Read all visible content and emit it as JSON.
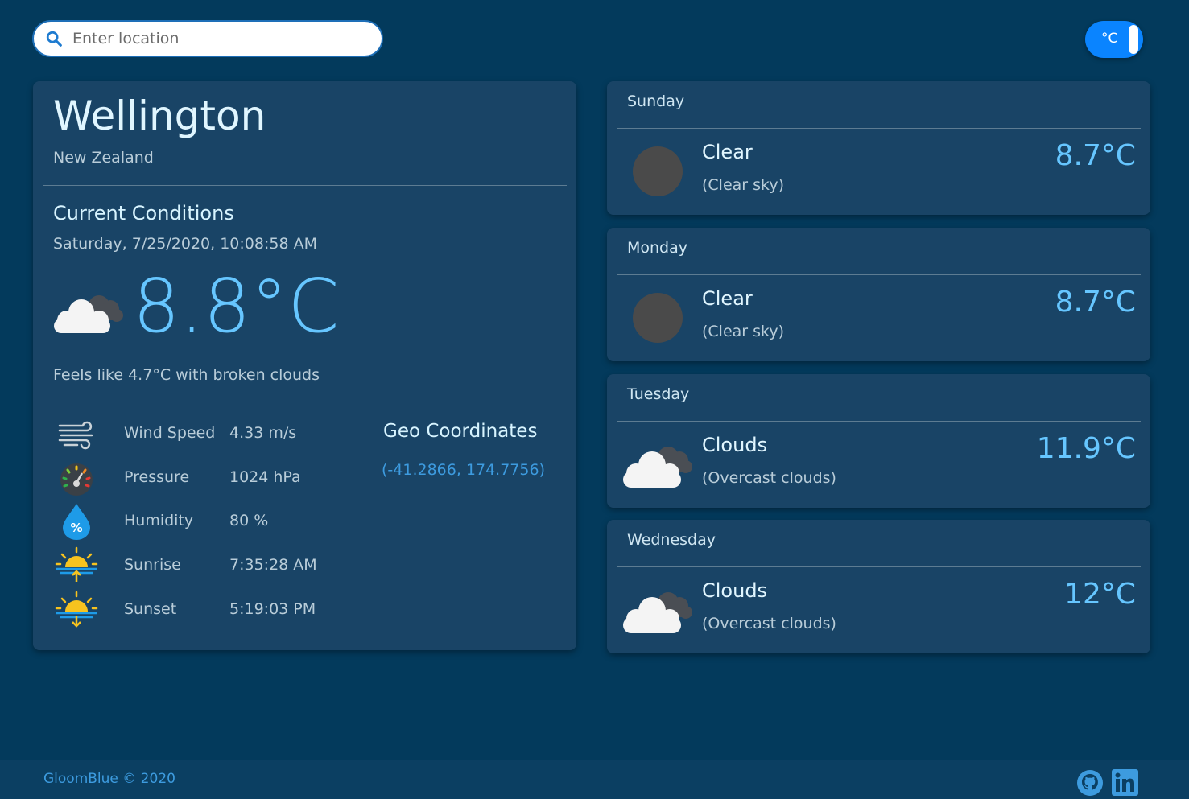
{
  "search": {
    "placeholder": "Enter location"
  },
  "unit_toggle": {
    "label": "°C"
  },
  "current": {
    "city": "Wellington",
    "country": "New Zealand",
    "section_title": "Current Conditions",
    "datetime": "Saturday, 7/25/2020, 10:08:58 AM",
    "icon": "broken-clouds-icon",
    "temperature": "8.8°C",
    "feels_like": "Feels like 4.7°C with broken clouds"
  },
  "stats": [
    {
      "label": "Wind Speed",
      "value": "4.33 m/s",
      "icon": "wind-icon"
    },
    {
      "label": "Pressure",
      "value": "1024 hPa",
      "icon": "gauge-icon"
    },
    {
      "label": "Humidity",
      "value": "80 %",
      "icon": "humidity-drop-icon"
    },
    {
      "label": "Sunrise",
      "value": "7:35:28 AM",
      "icon": "sunrise-icon"
    },
    {
      "label": "Sunset",
      "value": "5:19:03 PM",
      "icon": "sunset-icon"
    }
  ],
  "geo": {
    "title": "Geo Coordinates",
    "value": "(-41.2866, 174.7756)"
  },
  "forecast": [
    {
      "day": "Sunday",
      "condition": "Clear",
      "description": "(Clear sky)",
      "temperature": "8.7°C",
      "icon": "clear-night-moon-icon"
    },
    {
      "day": "Monday",
      "condition": "Clear",
      "description": "(Clear sky)",
      "temperature": "8.7°C",
      "icon": "clear-night-moon-icon"
    },
    {
      "day": "Tuesday",
      "condition": "Clouds",
      "description": "(Overcast clouds)",
      "temperature": "11.9°C",
      "icon": "overcast-clouds-icon"
    },
    {
      "day": "Wednesday",
      "condition": "Clouds",
      "description": "(Overcast clouds)",
      "temperature": "12°C",
      "icon": "overcast-clouds-icon"
    }
  ],
  "footer": {
    "brand": "GloomBlue © 2020",
    "links": [
      "github-icon",
      "linkedin-icon"
    ]
  },
  "colors": {
    "background": "#033a5c",
    "card": "#194466",
    "accent_temp": "#66c6ff",
    "toggle": "#0a84ff",
    "link": "#3d9bdf"
  }
}
